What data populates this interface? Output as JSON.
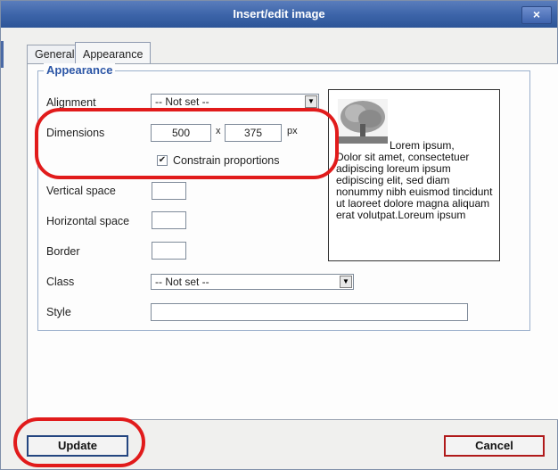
{
  "dialog": {
    "title": "Insert/edit image",
    "close_label": "×"
  },
  "tabs": [
    {
      "label": "General",
      "active": false
    },
    {
      "label": "Appearance",
      "active": true
    }
  ],
  "appearance": {
    "legend": "Appearance",
    "alignment": {
      "label": "Alignment",
      "value": "-- Not set --"
    },
    "dimensions": {
      "label": "Dimensions",
      "width": "500",
      "separator": "x",
      "height": "375",
      "unit": "px"
    },
    "constrain": {
      "label": "Constrain proportions",
      "checked": true
    },
    "vertical_space": {
      "label": "Vertical space",
      "value": ""
    },
    "horizontal_space": {
      "label": "Horizontal space",
      "value": ""
    },
    "border": {
      "label": "Border",
      "value": ""
    },
    "class": {
      "label": "Class",
      "value": "-- Not set --"
    },
    "style": {
      "label": "Style",
      "value": ""
    }
  },
  "preview": {
    "first_line": "Lorem ipsum,",
    "text": "Dolor sit amet, consectetuer adipiscing loreum ipsum edipiscing elit, sed diam nonummy nibh euismod tincidunt ut laoreet dolore magna aliquam erat volutpat.Loreum ipsum"
  },
  "buttons": {
    "update": "Update",
    "cancel": "Cancel"
  },
  "colors": {
    "title_bar": "#3b63a8",
    "callout": "#e11b1b",
    "legend": "#2c56a6"
  }
}
